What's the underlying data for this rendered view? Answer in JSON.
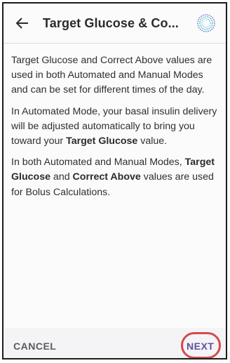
{
  "header": {
    "back_icon": "arrow-left-icon",
    "title": "Target Glucose & Co...",
    "status_icon": "activity-ring-icon"
  },
  "content": {
    "p1": "Target Glucose and Correct Above values are used in both Automated and Manual Modes and can be set for different times of the day.",
    "p2_before": "In Automated Mode, your basal insulin delivery will be adjusted automatically to bring you toward your ",
    "p2_bold": "Target Glucose",
    "p2_after": " value.",
    "p3_before": "In both Automated and Manual Modes, ",
    "p3_bold1": "Target Glucose",
    "p3_mid": " and ",
    "p3_bold2": "Correct Above",
    "p3_after": " values are used for Bolus Calculations."
  },
  "footer": {
    "cancel_label": "CANCEL",
    "next_label": "NEXT"
  },
  "colors": {
    "accent": "#5f4fa0",
    "highlight": "#d44a4a",
    "footer_bg": "#f4f4f7"
  }
}
